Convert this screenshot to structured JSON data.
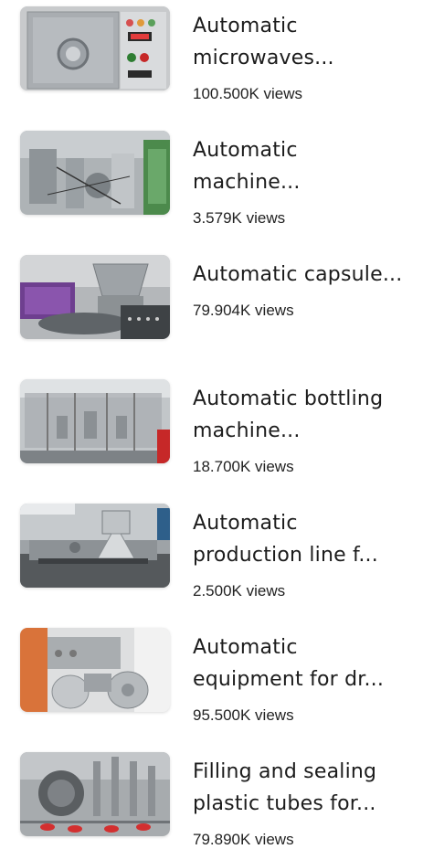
{
  "videos": [
    {
      "title": "Automatic microwaves...",
      "views": "100.500K views",
      "thumb_icon": "microwave-machine-thumbnail"
    },
    {
      "title": "Automatic machine...",
      "views": "3.579K views",
      "thumb_icon": "machine-thumbnail"
    },
    {
      "title": "Automatic capsule...",
      "views": "79.904K views",
      "thumb_icon": "capsule-machine-thumbnail"
    },
    {
      "title": "Automatic bottling machine...",
      "views": "18.700K views",
      "thumb_icon": "bottling-machine-thumbnail"
    },
    {
      "title": "Automatic production line f...",
      "views": "2.500K views",
      "thumb_icon": "production-line-thumbnail"
    },
    {
      "title": "Automatic equipment for dr...",
      "views": "95.500K views",
      "thumb_icon": "equipment-thumbnail"
    },
    {
      "title": "Filling and sealing plastic tubes for...",
      "views": "79.890K views",
      "thumb_icon": "tube-filling-thumbnail"
    }
  ]
}
